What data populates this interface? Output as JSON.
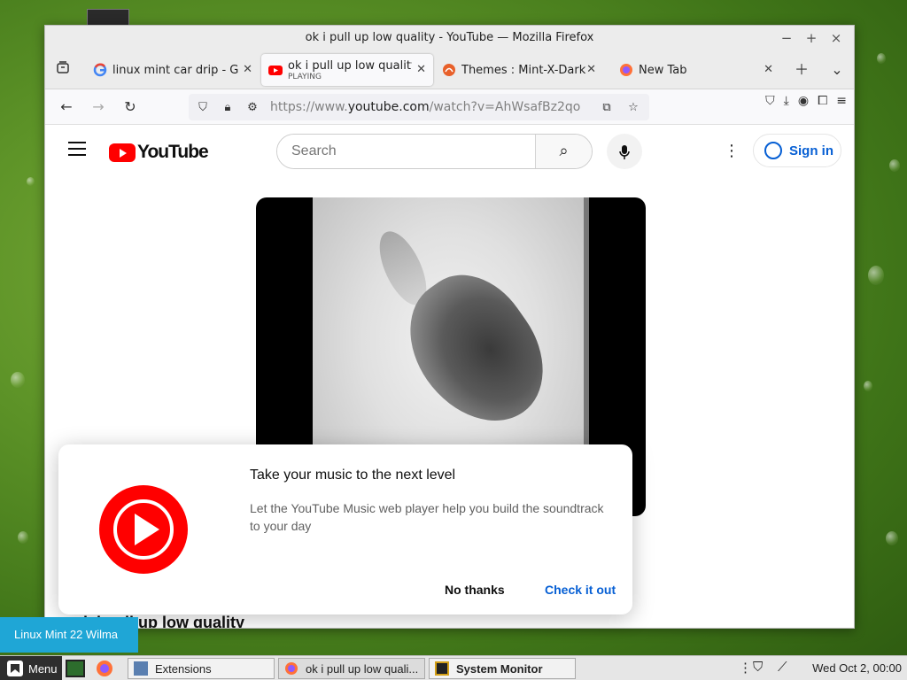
{
  "window": {
    "title": "ok i pull up low quality - YouTube — Mozilla Firefox",
    "controls": [
      "−",
      "+",
      "×"
    ]
  },
  "tabs": [
    {
      "label": "linux mint car drip - Goo",
      "favicon": "google-icon"
    },
    {
      "label": "ok i pull up low quality",
      "sublabel": "PLAYING",
      "favicon": "youtube-icon",
      "active": true
    },
    {
      "label": "Themes : Mint-X-Dark : C",
      "favicon": "themes-icon"
    },
    {
      "label": "New Tab",
      "favicon": "firefox-icon"
    }
  ],
  "url": {
    "prefix": "https://www.",
    "domain": "youtube.com",
    "path": "/watch?v=AhWsafBz2qo"
  },
  "youtube": {
    "logo_text": "YouTube",
    "search_placeholder": "Search",
    "signin_label": "Sign in",
    "video_title": "ok i pull up low quality"
  },
  "popup": {
    "title": "Take your music to the next level",
    "description": "Let the YouTube Music web player help you build the soundtrack to your day",
    "dismiss_label": "No thanks",
    "accept_label": "Check it out"
  },
  "tooltip": "Linux Mint 22 Wilma",
  "taskbar": {
    "menu_label": "Menu",
    "tasks": [
      "Extensions",
      "ok i pull up low quali...",
      "System Monitor"
    ],
    "clock": "Wed Oct  2, 00:00"
  },
  "colors": {
    "youtube_red": "#ff0000",
    "link_blue": "#065fd4",
    "tooltip_blue": "#1fa6d6"
  }
}
